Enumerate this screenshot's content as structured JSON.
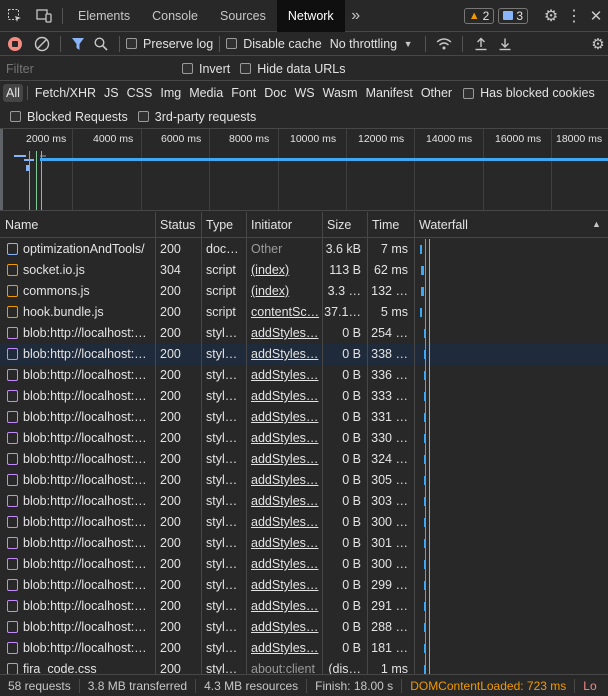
{
  "tabs": {
    "items": [
      "Elements",
      "Console",
      "Sources",
      "Network"
    ],
    "active": "Network",
    "warnings_count": "2",
    "messages_count": "3"
  },
  "toolbar": {
    "preserve_log": "Preserve log",
    "disable_cache": "Disable cache",
    "throttling": "No throttling"
  },
  "filter": {
    "placeholder": "Filter",
    "invert": "Invert",
    "hide_data_urls": "Hide data URLs"
  },
  "types": {
    "items": [
      "All",
      "Fetch/XHR",
      "JS",
      "CSS",
      "Img",
      "Media",
      "Font",
      "Doc",
      "WS",
      "Wasm",
      "Manifest",
      "Other"
    ],
    "active": "All",
    "has_blocked_cookies": "Has blocked cookies"
  },
  "blocking": {
    "blocked_requests": "Blocked Requests",
    "third_party": "3rd-party requests"
  },
  "overview": {
    "ticks": [
      "2000 ms",
      "4000 ms",
      "6000 ms",
      "8000 ms",
      "10000 ms",
      "12000 ms",
      "14000 ms",
      "16000 ms",
      "18000 ms"
    ]
  },
  "columns": {
    "name": "Name",
    "status": "Status",
    "type": "Type",
    "initiator": "Initiator",
    "size": "Size",
    "time": "Time",
    "waterfall": "Waterfall"
  },
  "rows": [
    {
      "kind": "doc",
      "name": "optimizationAndTools/",
      "status": "200",
      "type": "doc…",
      "initiator": "Other",
      "size": "3.6 kB",
      "time": "7 ms"
    },
    {
      "kind": "script",
      "name": "socket.io.js",
      "status": "304",
      "type": "script",
      "initiator": "(index)",
      "size": "113 B",
      "time": "62 ms"
    },
    {
      "kind": "script",
      "name": "commons.js",
      "status": "200",
      "type": "script",
      "initiator": "(index)",
      "size": "3.3 …",
      "time": "132 …"
    },
    {
      "kind": "script",
      "name": "hook.bundle.js",
      "status": "200",
      "type": "script",
      "initiator": "contentSc…",
      "size": "37.1…",
      "time": "5 ms"
    },
    {
      "kind": "style",
      "name": "blob:http://localhost:…",
      "status": "200",
      "type": "styl…",
      "initiator": "addStyles…",
      "size": "0 B",
      "time": "254 …"
    },
    {
      "kind": "style",
      "name": "blob:http://localhost:…",
      "status": "200",
      "type": "styl…",
      "initiator": "addStyles…",
      "size": "0 B",
      "time": "338 …"
    },
    {
      "kind": "style",
      "name": "blob:http://localhost:…",
      "status": "200",
      "type": "styl…",
      "initiator": "addStyles…",
      "size": "0 B",
      "time": "336 …"
    },
    {
      "kind": "style",
      "name": "blob:http://localhost:…",
      "status": "200",
      "type": "styl…",
      "initiator": "addStyles…",
      "size": "0 B",
      "time": "333 …"
    },
    {
      "kind": "style",
      "name": "blob:http://localhost:…",
      "status": "200",
      "type": "styl…",
      "initiator": "addStyles…",
      "size": "0 B",
      "time": "331 …"
    },
    {
      "kind": "style",
      "name": "blob:http://localhost:…",
      "status": "200",
      "type": "styl…",
      "initiator": "addStyles…",
      "size": "0 B",
      "time": "330 …"
    },
    {
      "kind": "style",
      "name": "blob:http://localhost:…",
      "status": "200",
      "type": "styl…",
      "initiator": "addStyles…",
      "size": "0 B",
      "time": "324 …"
    },
    {
      "kind": "style",
      "name": "blob:http://localhost:…",
      "status": "200",
      "type": "styl…",
      "initiator": "addStyles…",
      "size": "0 B",
      "time": "305 …"
    },
    {
      "kind": "style",
      "name": "blob:http://localhost:…",
      "status": "200",
      "type": "styl…",
      "initiator": "addStyles…",
      "size": "0 B",
      "time": "303 …"
    },
    {
      "kind": "style",
      "name": "blob:http://localhost:…",
      "status": "200",
      "type": "styl…",
      "initiator": "addStyles…",
      "size": "0 B",
      "time": "300 …"
    },
    {
      "kind": "style",
      "name": "blob:http://localhost:…",
      "status": "200",
      "type": "styl…",
      "initiator": "addStyles…",
      "size": "0 B",
      "time": "301 …"
    },
    {
      "kind": "style",
      "name": "blob:http://localhost:…",
      "status": "200",
      "type": "styl…",
      "initiator": "addStyles…",
      "size": "0 B",
      "time": "300 …"
    },
    {
      "kind": "style",
      "name": "blob:http://localhost:…",
      "status": "200",
      "type": "styl…",
      "initiator": "addStyles…",
      "size": "0 B",
      "time": "299 …"
    },
    {
      "kind": "style",
      "name": "blob:http://localhost:…",
      "status": "200",
      "type": "styl…",
      "initiator": "addStyles…",
      "size": "0 B",
      "time": "291 …"
    },
    {
      "kind": "style",
      "name": "blob:http://localhost:…",
      "status": "200",
      "type": "styl…",
      "initiator": "addStyles…",
      "size": "0 B",
      "time": "288 …"
    },
    {
      "kind": "style",
      "name": "blob:http://localhost:…",
      "status": "200",
      "type": "styl…",
      "initiator": "addStyles…",
      "size": "0 B",
      "time": "181 …"
    },
    {
      "kind": "style",
      "name": "fira_code.css",
      "status": "200",
      "type": "styl…",
      "initiator": "about:client",
      "size": "(dis…",
      "time": "1 ms"
    }
  ],
  "selected_row": 5,
  "status": {
    "requests": "58 requests",
    "transferred": "3.8 MB transferred",
    "resources": "4.3 MB resources",
    "finish": "Finish: 18.00 s",
    "dcl": "DOMContentLoaded: 723 ms",
    "load": "Lo"
  },
  "colors": {
    "accent": "#8ab4f8",
    "record": "#f28b82",
    "dcl": "#f29900",
    "doc_icon": "#8ab4f8",
    "script_icon": "#f29900",
    "style_icon": "#c58af9",
    "selected_row": "#1f2a3a"
  }
}
